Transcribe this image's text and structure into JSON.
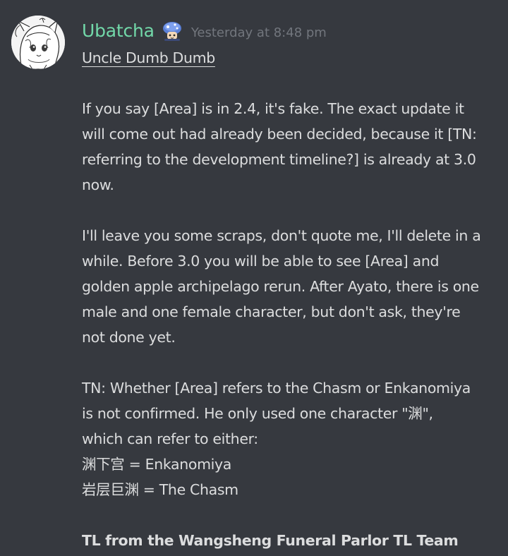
{
  "author": {
    "username": "Ubatcha",
    "badge_icon": "paimon-mushroom-icon",
    "timestamp": "Yesterday at 8:48 pm",
    "avatar_icon": "anime-avatar-icon"
  },
  "message": {
    "title": "Uncle Dumb Dumb",
    "paragraph1": [
      "If you say [Area] is in 2.4, it's fake. The exact update it",
      "will come out had already been decided, because it [TN:",
      "referring to the development timeline?] is already at 3.0",
      "now."
    ],
    "paragraph2": [
      "I'll leave you some scraps, don't quote me, I'll delete in a",
      "while. Before 3.0 you will be able to see [Area] and",
      "golden apple archipelago rerun. After Ayato, there is one",
      "male and one female character, but don't ask, they're",
      "not done yet."
    ],
    "paragraph3": [
      "TN: Whether [Area] refers to the Chasm or Enkanomiya",
      "is not confirmed. He only used one character \"渊\",",
      "which can refer to either:",
      "渊下宫 = Enkanomiya",
      "岩层巨渊 = The Chasm"
    ],
    "footer": "TL from the Wangsheng Funeral Parlor TL Team"
  },
  "colors": {
    "background": "#36393f",
    "username": "#72d8a9",
    "timestamp": "#72767d",
    "text": "#dcddde"
  }
}
